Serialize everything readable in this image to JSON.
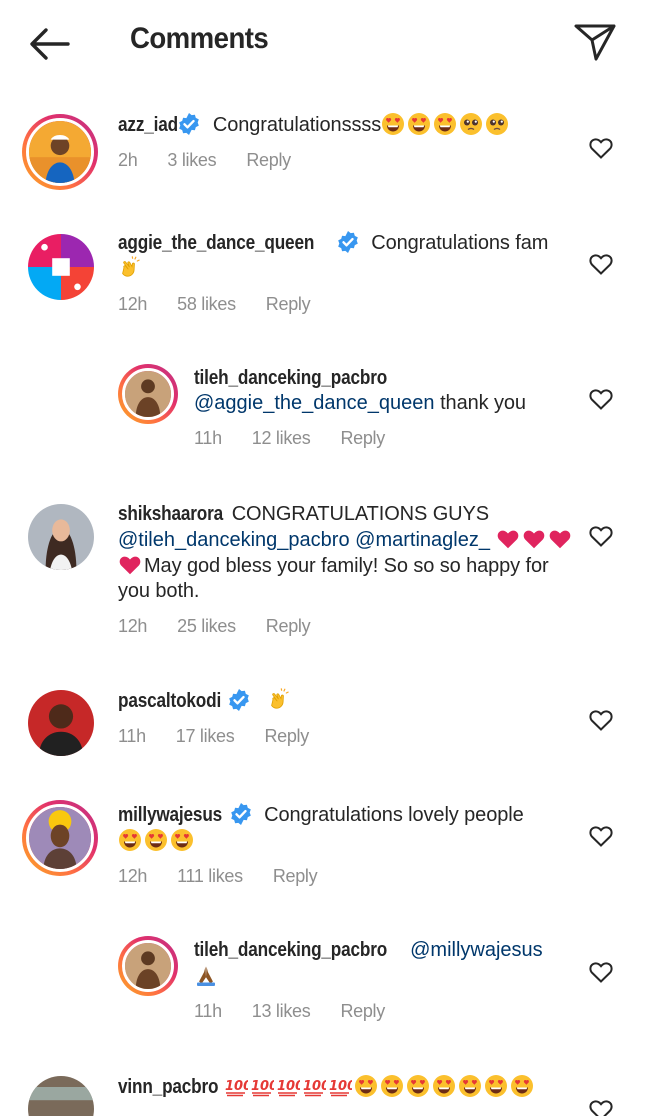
{
  "header": {
    "title": "Comments",
    "back_icon": "arrow-left-icon",
    "share_icon": "paper-plane-icon"
  },
  "colors": {
    "text": "#262626",
    "muted": "#8e8e8e",
    "mention": "#00376b",
    "verified": "#3897f0"
  },
  "comments": [
    {
      "username": "azz_iad",
      "verified": true,
      "text": "Congratulationssss",
      "emojis": [
        "heart-eyes-emoji",
        "heart-eyes-emoji",
        "heart-eyes-emoji",
        "pleading-face-emoji",
        "pleading-face-emoji"
      ],
      "time": "2h",
      "likes": "3 likes",
      "reply": "Reply"
    },
    {
      "username": "aggie_the_dance_queen",
      "verified": true,
      "text": "Congratulations fam",
      "emojis": [
        "clapping-hands-emoji"
      ],
      "time": "12h",
      "likes": "58 likes",
      "reply": "Reply"
    },
    {
      "username": "tileh_danceking_pacbro",
      "verified": false,
      "mention": "@aggie_the_dance_queen",
      "text": "thank you",
      "time": "11h",
      "likes": "12 likes",
      "reply": "Reply"
    },
    {
      "username": "shikshaarora",
      "verified": false,
      "text_line1": "CONGRATULATIONS GUYS",
      "mention1": "@tileh_danceking_pacbro",
      "mention2": "@martinaglez_",
      "text_line3": "May god bless your family! So so so happy for",
      "text_line4": "you both.",
      "emojis": [
        "red-heart-emoji",
        "red-heart-emoji",
        "red-heart-emoji",
        "red-heart-emoji"
      ],
      "time": "12h",
      "likes": "25 likes",
      "reply": "Reply"
    },
    {
      "username": "pascaltokodi",
      "verified": true,
      "emojis": [
        "clapping-hands-emoji"
      ],
      "time": "11h",
      "likes": "17 likes",
      "reply": "Reply"
    },
    {
      "username": "millywajesus",
      "verified": true,
      "text": "Congratulations lovely people",
      "emojis": [
        "heart-eyes-emoji",
        "heart-eyes-emoji",
        "heart-eyes-emoji"
      ],
      "time": "12h",
      "likes": "111 likes",
      "reply": "Reply"
    },
    {
      "username": "tileh_danceking_pacbro",
      "verified": false,
      "mention": "@millywajesus",
      "emojis": [
        "folded-hands-emoji"
      ],
      "time": "11h",
      "likes": "13 likes",
      "reply": "Reply"
    },
    {
      "username": "vinn_pacbro",
      "verified": false,
      "emojis": [
        "hundred-points-emoji",
        "hundred-points-emoji",
        "hundred-points-emoji",
        "hundred-points-emoji",
        "hundred-points-emoji",
        "heart-eyes-emoji",
        "heart-eyes-emoji",
        "heart-eyes-emoji",
        "heart-eyes-emoji",
        "heart-eyes-emoji",
        "heart-eyes-emoji",
        "heart-eyes-emoji"
      ]
    }
  ]
}
